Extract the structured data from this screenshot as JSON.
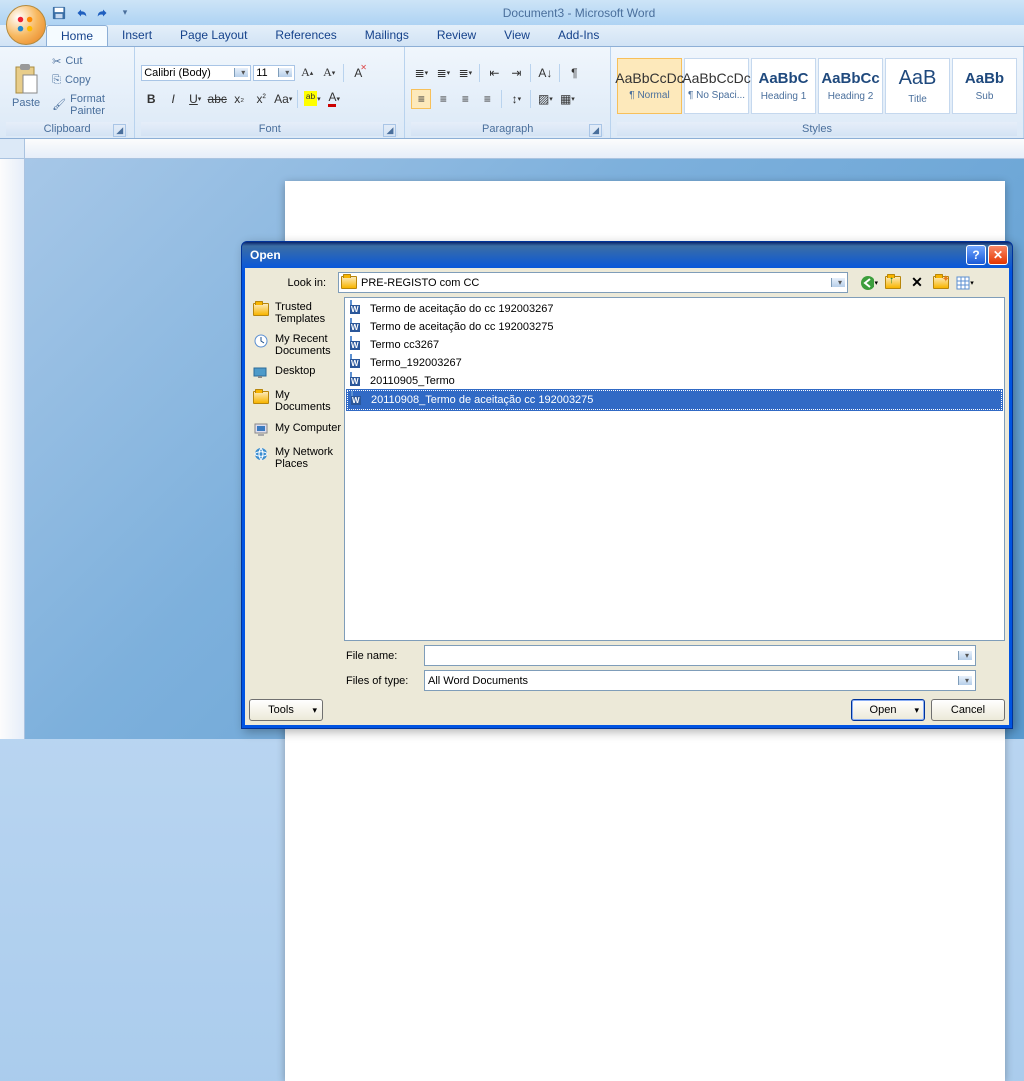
{
  "app": {
    "title": "Document3 - Microsoft Word"
  },
  "tabs": {
    "home": "Home",
    "insert": "Insert",
    "page_layout": "Page Layout",
    "references": "References",
    "mailings": "Mailings",
    "review": "Review",
    "view": "View",
    "addins": "Add-Ins"
  },
  "ribbon": {
    "clipboard": {
      "label": "Clipboard",
      "paste": "Paste",
      "cut": "Cut",
      "copy": "Copy",
      "format_painter": "Format Painter"
    },
    "font": {
      "label": "Font",
      "name": "Calibri (Body)",
      "size": "11"
    },
    "paragraph": {
      "label": "Paragraph"
    },
    "styles": {
      "label": "Styles",
      "items": [
        {
          "sample": "AaBbCcDc",
          "label": "¶ Normal",
          "cls": ""
        },
        {
          "sample": "AaBbCcDc",
          "label": "¶ No Spaci...",
          "cls": ""
        },
        {
          "sample": "AaBbC",
          "label": "Heading 1",
          "cls": "h1"
        },
        {
          "sample": "AaBbCc",
          "label": "Heading 2",
          "cls": "h1"
        },
        {
          "sample": "AaB",
          "label": "Title",
          "cls": "title"
        },
        {
          "sample": "AaBb",
          "label": "Sub",
          "cls": "h1"
        }
      ]
    }
  },
  "dialog": {
    "title": "Open",
    "look_in_label": "Look in:",
    "look_in_value": "PRE-REGISTO com CC",
    "places": [
      {
        "icon": "folder",
        "label": "Trusted Templates"
      },
      {
        "icon": "clock",
        "label": "My Recent Documents"
      },
      {
        "icon": "desktop",
        "label": "Desktop"
      },
      {
        "icon": "folder",
        "label": "My Documents"
      },
      {
        "icon": "computer",
        "label": "My Computer"
      },
      {
        "icon": "network",
        "label": "My Network Places"
      }
    ],
    "files": [
      {
        "name": "Termo de aceitação do cc 192003267",
        "selected": false
      },
      {
        "name": "Termo de aceitação do cc 192003275",
        "selected": false
      },
      {
        "name": "Termo cc3267",
        "selected": false
      },
      {
        "name": "Termo_192003267",
        "selected": false
      },
      {
        "name": "20110905_Termo",
        "selected": false
      },
      {
        "name": "20110908_Termo de aceitação cc 192003275",
        "selected": true
      }
    ],
    "file_name_label": "File name:",
    "file_name_value": "",
    "file_type_label": "Files of type:",
    "file_type_value": "All Word Documents",
    "tools_btn": "Tools",
    "open_btn": "Open",
    "cancel_btn": "Cancel"
  }
}
